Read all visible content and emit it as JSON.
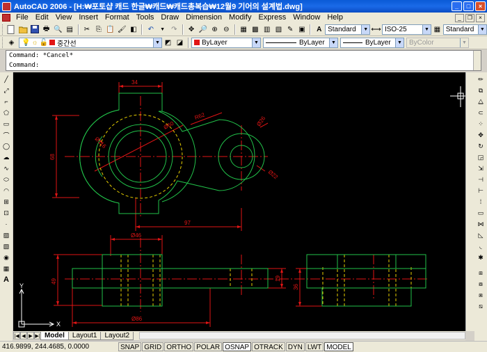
{
  "window": {
    "title": "AutoCAD 2006 - [H:₩포토샵 캐드 한글₩캐드₩캐드총복습₩12월9 기어의 설계법.dwg]"
  },
  "menu": {
    "items": [
      "File",
      "Edit",
      "View",
      "Insert",
      "Format",
      "Tools",
      "Draw",
      "Dimension",
      "Modify",
      "Express",
      "Window",
      "Help"
    ]
  },
  "toolbar_std": {
    "textstyle": "Standard",
    "dimstyle": "ISO-25",
    "tablestyle": "Standard"
  },
  "toolbar_layers": {
    "layer": "중간선",
    "color": "ByLayer",
    "linetype": "ByLayer",
    "lineweight": "ByLayer",
    "plotstyle": "ByColor"
  },
  "command": {
    "history": "Command: *Cancel*",
    "prompt": "Command:"
  },
  "drawing": {
    "dims": {
      "top_width": "34",
      "dia60": "Ø60",
      "r62": "R62",
      "dia116": "Ø116",
      "dia26": "Ø26",
      "dia22": "Ø22",
      "height68": "68",
      "len97": "97",
      "dia46": "Ø46",
      "height49": "49",
      "height19": "19",
      "height36": "36",
      "dia86": "Ø86"
    },
    "ucs_x": "X",
    "ucs_y": "Y"
  },
  "tabs": {
    "model": "Model",
    "layout1": "Layout1",
    "layout2": "Layout2"
  },
  "status": {
    "coords": "416.9899, 244.4685, 0.0000",
    "buttons": [
      {
        "label": "SNAP",
        "on": false
      },
      {
        "label": "GRID",
        "on": false
      },
      {
        "label": "ORTHO",
        "on": false
      },
      {
        "label": "POLAR",
        "on": false
      },
      {
        "label": "OSNAP",
        "on": true
      },
      {
        "label": "OTRACK",
        "on": false
      },
      {
        "label": "DYN",
        "on": false
      },
      {
        "label": "LWT",
        "on": false
      },
      {
        "label": "MODEL",
        "on": true
      }
    ]
  },
  "colors": {
    "geometry": "#22c24a",
    "dimension": "#e11515",
    "centerline": "#e11515",
    "hidden": "#e8d000",
    "canvas": "#000000"
  },
  "icons": {
    "left_toolbar": [
      "line-icon",
      "xline-icon",
      "polyline-icon",
      "polygon-icon",
      "rectangle-icon",
      "arc-icon",
      "circle-icon",
      "revcloud-icon",
      "spline-icon",
      "ellipse-icon",
      "ellipse-arc-icon",
      "insert-block-icon",
      "make-block-icon",
      "point-icon",
      "hatch-icon",
      "gradient-icon",
      "region-icon",
      "table-icon",
      "mtext-icon"
    ],
    "right_toolbar": [
      "erase-icon",
      "copy-icon",
      "mirror-icon",
      "offset-icon",
      "array-icon",
      "move-icon",
      "rotate-icon",
      "scale-icon",
      "stretch-icon",
      "trim-icon",
      "extend-icon",
      "break-point-icon",
      "break-icon",
      "join-icon",
      "chamfer-icon",
      "fillet-icon",
      "explode-icon"
    ]
  }
}
